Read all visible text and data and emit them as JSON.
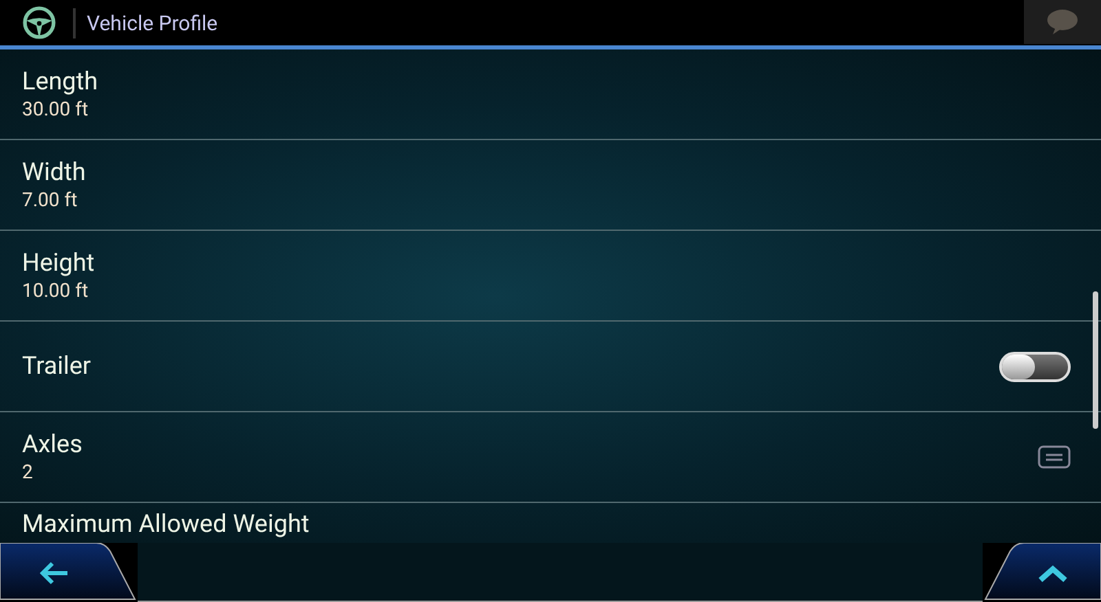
{
  "header": {
    "title": "Vehicle Profile"
  },
  "settings": [
    {
      "kind": "value",
      "label": "Length",
      "value": "30.00 ft"
    },
    {
      "kind": "value",
      "label": "Width",
      "value": "7.00 ft"
    },
    {
      "kind": "value",
      "label": "Height",
      "value": "10.00 ft"
    },
    {
      "kind": "toggle",
      "label": "Trailer",
      "on": false
    },
    {
      "kind": "select",
      "label": "Axles",
      "value": "2"
    },
    {
      "kind": "heading",
      "label": "Maximum Allowed Weight"
    }
  ]
}
